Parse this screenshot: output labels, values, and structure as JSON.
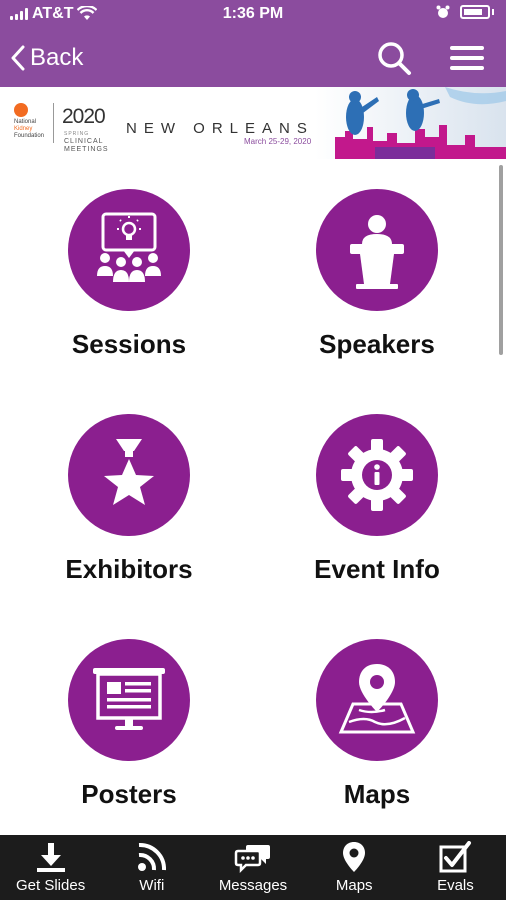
{
  "status": {
    "carrier": "AT&T",
    "time": "1:36 PM"
  },
  "nav": {
    "back_label": "Back"
  },
  "banner": {
    "org": [
      "National",
      "Kidney",
      "Foundation"
    ],
    "year": "2020",
    "subtitle": [
      "SPRING",
      "CLINICAL",
      "MEETINGS"
    ],
    "city": "NEW ORLEANS",
    "dates": "March 25-29, 2020"
  },
  "tiles": [
    {
      "label": "Sessions",
      "icon": "presentation-audience-icon"
    },
    {
      "label": "Speakers",
      "icon": "podium-icon"
    },
    {
      "label": "Exhibitors",
      "icon": "star-trophy-icon"
    },
    {
      "label": "Event Info",
      "icon": "info-gear-icon"
    },
    {
      "label": "Posters",
      "icon": "poster-board-icon"
    },
    {
      "label": "Maps",
      "icon": "map-pin-icon"
    }
  ],
  "tabbar": [
    {
      "label": "Get Slides",
      "icon": "download-icon"
    },
    {
      "label": "Wifi",
      "icon": "wifi-icon"
    },
    {
      "label": "Messages",
      "icon": "chat-bubbles-icon"
    },
    {
      "label": "Maps",
      "icon": "location-pin-icon"
    },
    {
      "label": "Evals",
      "icon": "checkbox-icon"
    }
  ],
  "colors": {
    "primary": "#8b4c9e",
    "tile": "#8b1f8f",
    "tabbar": "#1c1c1c"
  }
}
